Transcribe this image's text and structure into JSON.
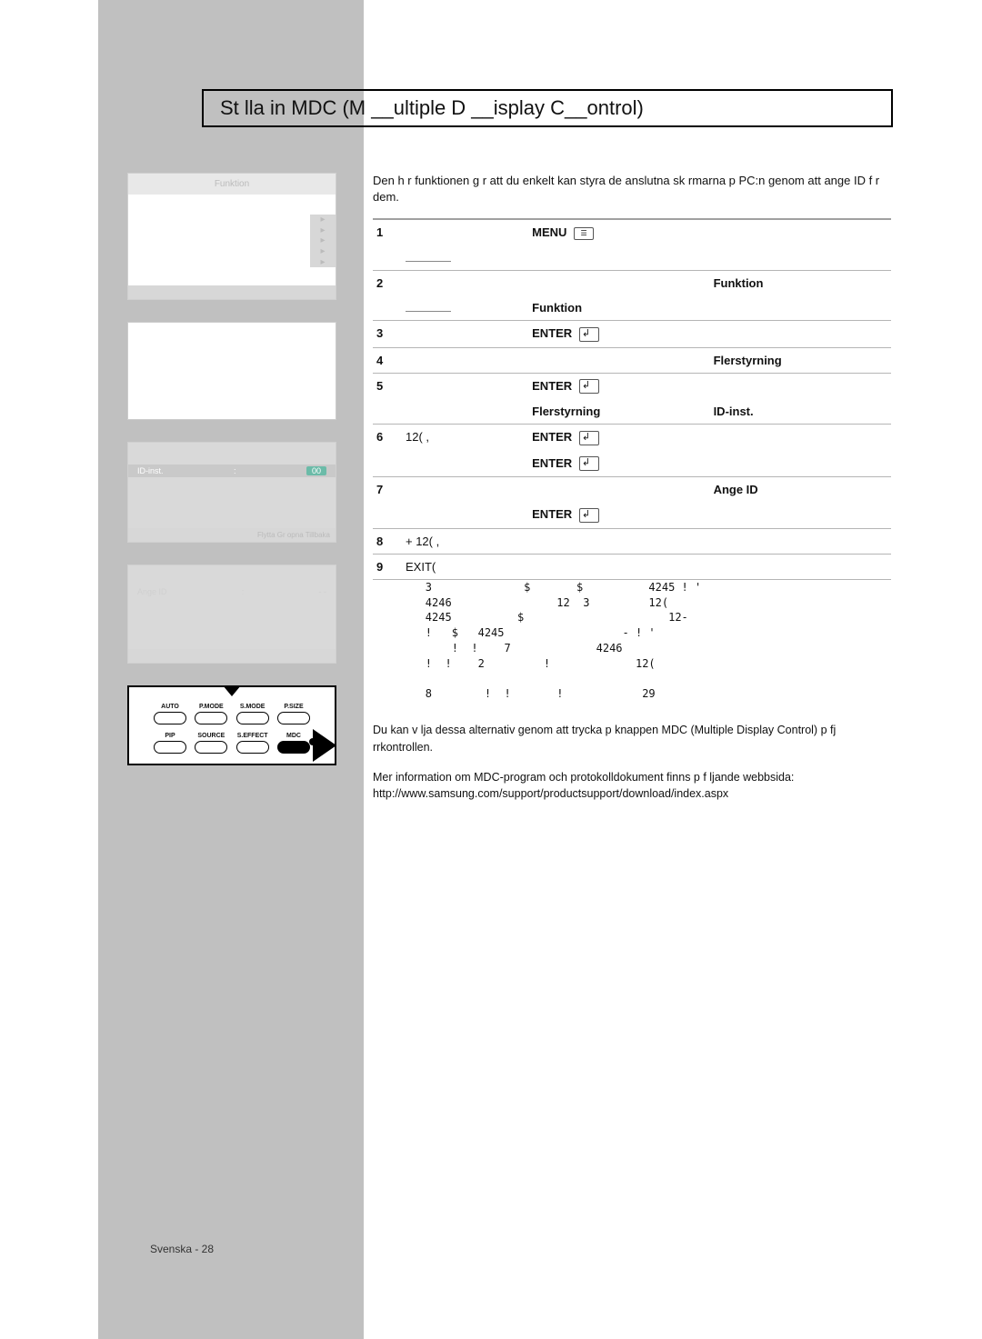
{
  "title": "St   lla in MDC (M __ultiple D __isplay C__ontrol)",
  "intro": "Den h  r funktionen g  r att du enkelt kan styra de anslutna sk  rmarna p   PC:n genom att ange ID f r dem.",
  "steps": [
    {
      "n": "1",
      "right": "MENU",
      "icon": "menu",
      "sub": ""
    },
    {
      "n": "2",
      "right": "Funktion",
      "sub": "Funktion"
    },
    {
      "n": "3",
      "right": "ENTER",
      "icon": "enter"
    },
    {
      "n": "4",
      "right": "Flerstyrning"
    },
    {
      "n": "5",
      "right": "ENTER",
      "icon": "enter",
      "sub1": "Flerstyrning",
      "sub2": "ID-inst."
    },
    {
      "n": "6",
      "left": "12(         ,",
      "right": "ENTER",
      "icon": "enter",
      "right2": "ENTER",
      "icon2": "enter"
    },
    {
      "n": "7",
      "right": "Ange ID",
      "sub": "ENTER",
      "subicon": "enter"
    },
    {
      "n": "8",
      "left": "+   12(                  ,"
    },
    {
      "n": "9",
      "left": "           EXIT("
    }
  ],
  "glitch_block": "        3              $       $          4245 ! '\n        4246                12  3         12(\n        4245          $                      12-\n        !   $   4245                  - ! '\n            !  !    7             4246\n        !  !    2         !             12(\n\n        8        !  !       !            29",
  "footnotes": [
    "Du kan v  lja dessa alternativ genom att trycka p knappen MDC (Multiple Display Control) p   fj  rrkontrollen.",
    "Mer information om MDC-program och protokolldokument finns p   f  ljande webbsida:",
    "http://www.samsung.com/support/productsupport/download/index.aspx"
  ],
  "left_panels": {
    "panel1_header": "Funktion",
    "panel3_label": "ID-inst.",
    "panel3_value": "00",
    "panel3_footer": "Flytta    Gr   opna    Tillbaka",
    "panel4_label": "Ange ID",
    "panel4_value": "- -"
  },
  "remote_buttons_top": [
    "AUTO",
    "P.MODE",
    "S.MODE",
    "P.SIZE"
  ],
  "remote_buttons_bot": [
    "PIP",
    "SOURCE",
    "S.EFFECT",
    "MDC"
  ],
  "page_footer": "Svenska - 28"
}
